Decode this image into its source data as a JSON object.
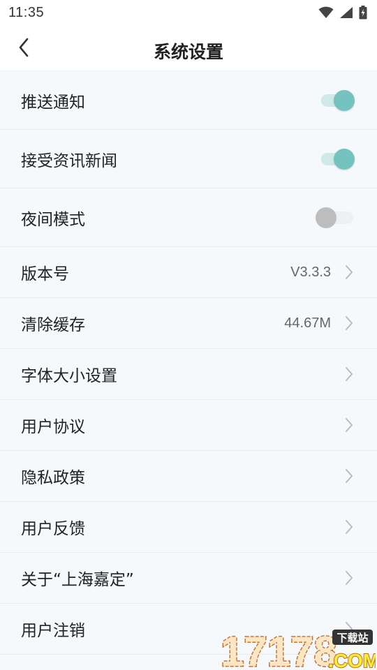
{
  "status_bar": {
    "time": "11:35",
    "icons": [
      "wifi-icon",
      "signal-icon",
      "battery-charging-icon"
    ]
  },
  "header": {
    "title": "系统设置",
    "back_icon": "chevron-left-icon"
  },
  "colors": {
    "toggle_on": "#74c3be",
    "toggle_track_on": "#cfe9e7",
    "toggle_off": "#bdbdbd",
    "background": "#f6f9fc"
  },
  "settings": [
    {
      "label": "推送通知",
      "toggle": true
    },
    {
      "label": "接受资讯新闻",
      "toggle": true
    },
    {
      "label": "夜间模式",
      "toggle": false
    },
    {
      "label": "版本号",
      "value": "V3.3.3"
    },
    {
      "label": "清除缓存",
      "value": "44.67M"
    },
    {
      "label": "字体大小设置"
    },
    {
      "label": "用户协议"
    },
    {
      "label": "隐私政策"
    },
    {
      "label": "用户反馈"
    },
    {
      "label": "关于“上海嘉定”"
    },
    {
      "label": "用户注销"
    }
  ],
  "watermark": {
    "number": "17178",
    "domain": ".COM",
    "badge": "下载站"
  }
}
